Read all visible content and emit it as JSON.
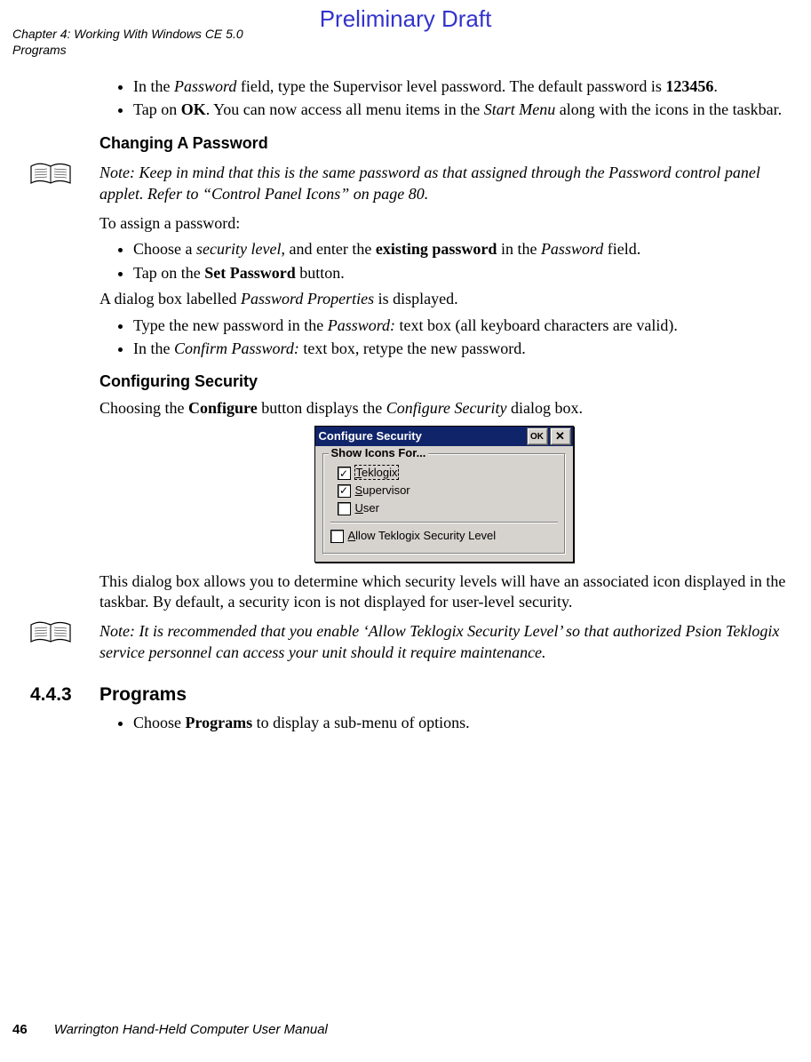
{
  "watermark": "Preliminary Draft",
  "header": {
    "line1": "Chapter 4:  Working With Windows CE 5.0",
    "line2": "Programs"
  },
  "body": {
    "bullets1_a_pre": "In the ",
    "bullets1_a_i1": "Password",
    "bullets1_a_mid": " field, type the Supervisor level password. The default password is ",
    "bullets1_a_b": "123456",
    "bullets1_a_post": ".",
    "bullets1_b_pre": "Tap on ",
    "bullets1_b_b": "OK",
    "bullets1_b_mid": ". You can now access all menu items in the ",
    "bullets1_b_i": "Start Menu",
    "bullets1_b_post": " along with the icons in the taskbar.",
    "sub1": "Changing A Password",
    "note1_label": "Note: ",
    "note1_text": "Keep in mind that this is the same password as that assigned through the Password control panel applet. Refer to “Control Panel Icons” on page 80.",
    "p1": "To assign a password:",
    "bullets2_a_pre": "Choose a ",
    "bullets2_a_i1": "security level",
    "bullets2_a_mid": ", and enter the ",
    "bullets2_a_b": "existing password",
    "bullets2_a_mid2": " in the ",
    "bullets2_a_i2": "Password",
    "bullets2_a_post": " field.",
    "bullets2_b_pre": "Tap on the ",
    "bullets2_b_b": "Set Password",
    "bullets2_b_post": " button.",
    "p2_pre": "A dialog box labelled ",
    "p2_i": "Password Properties",
    "p2_post": " is displayed.",
    "bullets3_a_pre": "Type the new password in the ",
    "bullets3_a_i": "Password:",
    "bullets3_a_post": " text box (all keyboard characters are valid).",
    "bullets3_b_pre": "In the ",
    "bullets3_b_i": "Confirm Password:",
    "bullets3_b_post": " text box, retype the new password.",
    "sub2": "Configuring Security",
    "p3_pre": "Choosing the ",
    "p3_b": "Configure",
    "p3_mid": " button displays the ",
    "p3_i": "Configure Security",
    "p3_post": " dialog box.",
    "p4": "This dialog box allows you to determine which security levels will have an associated icon displayed in the taskbar. By default, a security icon is not displayed for user-level security.",
    "note2_label": "Note: ",
    "note2_text": "It is recommended that you enable ‘Allow Teklogix Security Level’ so that authorized Psion Teklogix service personnel can access your unit should it require maintenance.",
    "secnum": "4.4.3",
    "sectitle": "Programs",
    "bullets4_pre": "Choose ",
    "bullets4_b": "Programs",
    "bullets4_post": " to display a sub-menu of options."
  },
  "dialog": {
    "title": "Configure Security",
    "ok": "OK",
    "legend": "Show Icons For...",
    "items": [
      {
        "label_u": "T",
        "label_rest": "eklogix",
        "checked": true,
        "selected": true
      },
      {
        "label_u": "S",
        "label_rest": "upervisor",
        "checked": true,
        "selected": false
      },
      {
        "label_u": "U",
        "label_rest": "ser",
        "checked": false,
        "selected": false
      }
    ],
    "allow_u": "A",
    "allow_rest": "llow Teklogix Security Level",
    "allow_checked": false
  },
  "footer": {
    "page": "46",
    "title": "Warrington Hand-Held Computer User Manual"
  }
}
